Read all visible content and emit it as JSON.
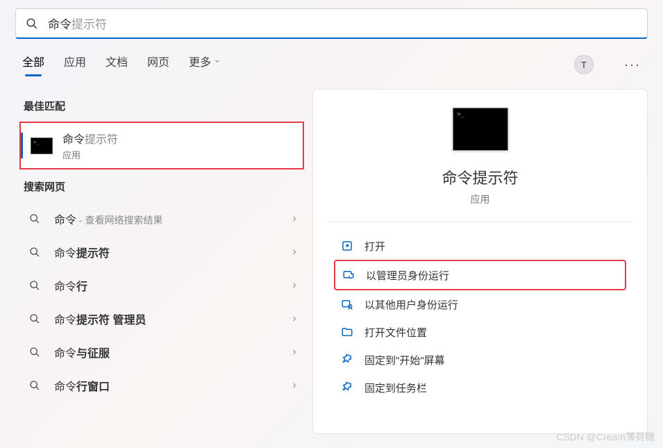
{
  "search": {
    "typed": "命令",
    "completion": "提示符"
  },
  "tabs": {
    "items": [
      {
        "label": "全部",
        "active": true
      },
      {
        "label": "应用",
        "active": false
      },
      {
        "label": "文档",
        "active": false
      },
      {
        "label": "网页",
        "active": false
      }
    ],
    "more": "更多"
  },
  "avatar": {
    "initial": "T"
  },
  "left": {
    "best_match_label": "最佳匹配",
    "best_match": {
      "title_typed": "命令",
      "title_rest": "提示符",
      "subtitle": "应用"
    },
    "web_search_label": "搜索网页",
    "web_items": [
      {
        "prefix": "命令",
        "bold": "",
        "hint": " - 查看网络搜索结果"
      },
      {
        "prefix": "命令",
        "bold": "提示符",
        "hint": ""
      },
      {
        "prefix": "命令",
        "bold": "行",
        "hint": ""
      },
      {
        "prefix": "命令",
        "bold": "提示符 管理员",
        "hint": ""
      },
      {
        "prefix": "命令",
        "bold": "与征服",
        "hint": ""
      },
      {
        "prefix": "命令",
        "bold": "行窗口",
        "hint": ""
      }
    ]
  },
  "right": {
    "title": "命令提示符",
    "subtitle": "应用",
    "actions": [
      {
        "icon": "open",
        "label": "打开",
        "highlight": false
      },
      {
        "icon": "admin",
        "label": "以管理员身份运行",
        "highlight": true
      },
      {
        "icon": "user",
        "label": "以其他用户身份运行",
        "highlight": false
      },
      {
        "icon": "folder",
        "label": "打开文件位置",
        "highlight": false
      },
      {
        "icon": "pin",
        "label": "固定到\"开始\"屏幕",
        "highlight": false
      },
      {
        "icon": "pin",
        "label": "固定到任务栏",
        "highlight": false
      }
    ]
  },
  "watermark": "CSDN @Cream薄荷糖"
}
